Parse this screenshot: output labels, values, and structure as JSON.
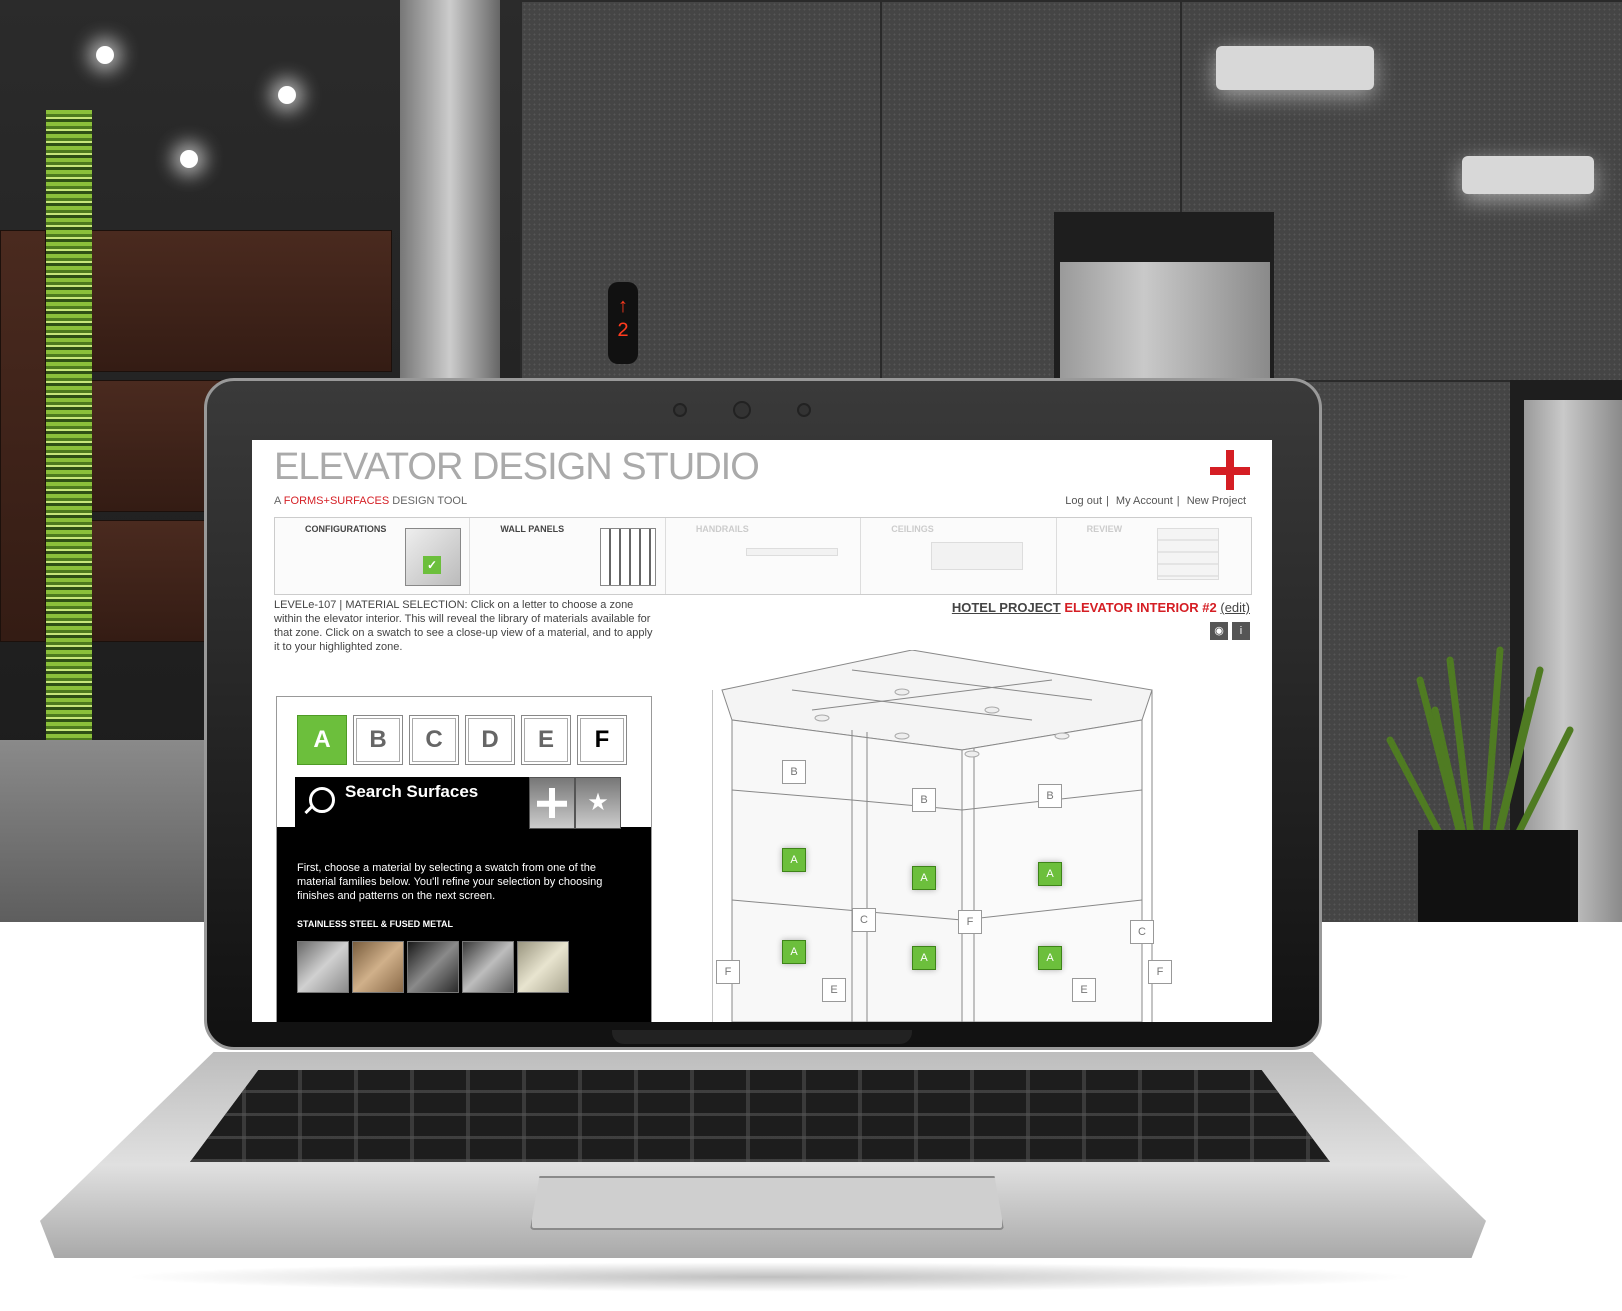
{
  "app": {
    "title": "ELEVATOR DESIGN STUDIO",
    "subtitle_prefix": "A",
    "subtitle_brand": "FORMS+SURFACES",
    "subtitle_suffix": "DESIGN TOOL",
    "brand_color": "#d51e24"
  },
  "top_links": [
    {
      "label": "Log out"
    },
    {
      "label": "My Account"
    },
    {
      "label": "New Project"
    }
  ],
  "steps": [
    {
      "label": "CONFIGURATIONS",
      "state": "complete"
    },
    {
      "label": "WALL PANELS",
      "state": "current"
    },
    {
      "label": "HANDRAILS",
      "state": "disabled"
    },
    {
      "label": "CEILINGS",
      "state": "disabled"
    },
    {
      "label": "REVIEW",
      "state": "disabled"
    }
  ],
  "instructions": "LEVELe-107 | MATERIAL SELECTION: Click on a letter to choose a zone within the elevator interior. This will reveal the library of materials available for that zone. Click on a swatch to see a close-up view of a material, and to apply it to your highlighted zone.",
  "project": {
    "name": "HOTEL PROJECT",
    "interior": "ELEVATOR INTERIOR #2",
    "edit_label": "(edit)"
  },
  "zones": [
    {
      "letter": "A",
      "active": true
    },
    {
      "letter": "B",
      "active": false
    },
    {
      "letter": "C",
      "active": false
    },
    {
      "letter": "D",
      "active": false
    },
    {
      "letter": "E",
      "active": false
    },
    {
      "letter": "F",
      "active": false
    }
  ],
  "search": {
    "label": "Search Surfaces"
  },
  "material_help": "First, choose a material by selecting a swatch from one of the material families below. You'll refine your selection by choosing finishes and patterns on the next screen.",
  "category": "STAINLESS STEEL & FUSED METAL",
  "swatch_colors": [
    "#b9b9b9",
    "#a38460",
    "#555555",
    "#7d7d7d",
    "#c9c4ae"
  ],
  "diagram_labels": {
    "b": "B",
    "a": "A",
    "c": "C",
    "f": "F",
    "e": "E"
  },
  "floor_indicator": {
    "arrow": "↑",
    "floor": "2"
  }
}
